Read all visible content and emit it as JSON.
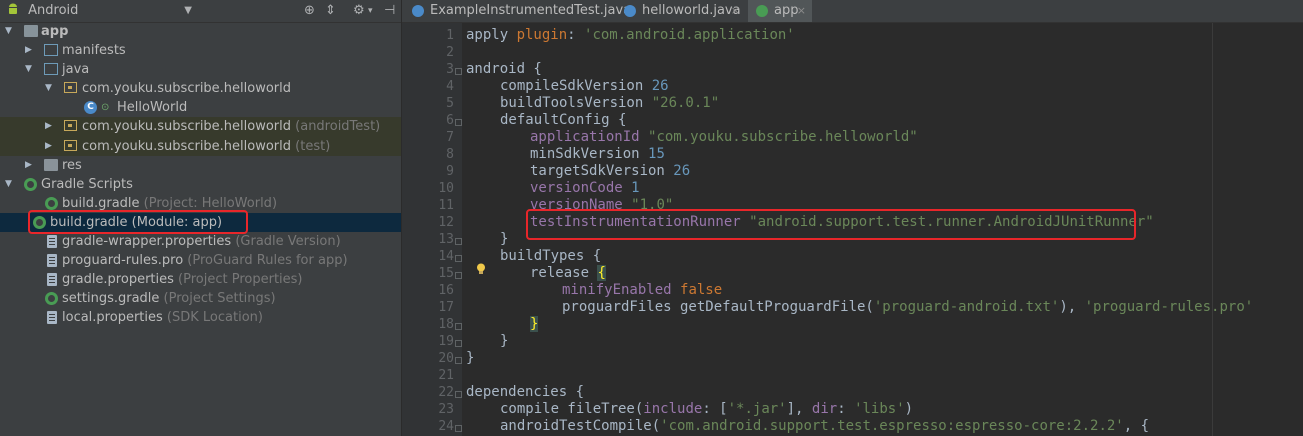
{
  "project": {
    "view_label": "Android",
    "toolbar_icons": [
      "target-icon",
      "collapse-icon",
      "gear-icon",
      "hide-icon"
    ],
    "tree": [
      {
        "label": "app",
        "hint": "",
        "bold": true
      },
      {
        "label": "manifests",
        "hint": ""
      },
      {
        "label": "java",
        "hint": ""
      },
      {
        "label": "com.youku.subscribe.helloworld",
        "hint": ""
      },
      {
        "label": "HelloWorld",
        "hint": ""
      },
      {
        "label": "com.youku.subscribe.helloworld",
        "hint": "(androidTest)"
      },
      {
        "label": "com.youku.subscribe.helloworld",
        "hint": "(test)"
      },
      {
        "label": "res",
        "hint": ""
      },
      {
        "label": "Gradle Scripts",
        "hint": ""
      },
      {
        "label": "build.gradle",
        "hint": "(Project: HelloWorld)"
      },
      {
        "label": "build.gradle (Module: app)",
        "hint": ""
      },
      {
        "label": "gradle-wrapper.properties",
        "hint": "(Gradle Version)"
      },
      {
        "label": "proguard-rules.pro",
        "hint": "(ProGuard Rules for app)"
      },
      {
        "label": "gradle.properties",
        "hint": "(Project Properties)"
      },
      {
        "label": "settings.gradle",
        "hint": "(Project Settings)"
      },
      {
        "label": "local.properties",
        "hint": "(SDK Location)"
      }
    ]
  },
  "tabs": [
    {
      "label": "ExampleInstrumentedTest.java",
      "active": false
    },
    {
      "label": "helloworld.java",
      "active": false
    },
    {
      "label": "app",
      "active": true
    }
  ],
  "tab_close_glyph": "×",
  "line_numbers": [
    "1",
    "2",
    "3",
    "4",
    "5",
    "6",
    "7",
    "8",
    "9",
    "10",
    "11",
    "12",
    "13",
    "14",
    "15",
    "16",
    "17",
    "18",
    "19",
    "20",
    "21",
    "22",
    "23",
    "24"
  ],
  "code": {
    "l1a": "apply ",
    "l1b": "plugin",
    "l1c": ": ",
    "l1d": "'com.android.application'",
    "l3": "android {",
    "l4a": "compileSdkVersion ",
    "l4b": "26",
    "l5a": "buildToolsVersion ",
    "l5b": "\"26.0.1\"",
    "l6": "defaultConfig {",
    "l7a": "applicationId ",
    "l7b": "\"com.youku.subscribe.helloworld\"",
    "l8a": "minSdkVersion ",
    "l8b": "15",
    "l9a": "targetSdkVersion ",
    "l9b": "26",
    "l10a": "versionCode ",
    "l10b": "1",
    "l11a": "versionName ",
    "l11b": "\"1.0\"",
    "l12a": "testInstrumentationRunner ",
    "l12b": "\"android.support.test.runner.AndroidJUnitRunner\"",
    "l13": "}",
    "l14": "buildTypes {",
    "l15a": "release ",
    "l15b": "{",
    "l16a": "minifyEnabled ",
    "l16b": "false",
    "l17a": "proguardFiles getDefaultProguardFile(",
    "l17b": "'proguard-android.txt'",
    "l17c": "), ",
    "l17d": "'proguard-rules.pro'",
    "l18": "}",
    "l19": "}",
    "l20": "}",
    "l22": "dependencies {",
    "l23a": "compile fileTree(",
    "l23b": "include",
    "l23c": ": [",
    "l23d": "'*.jar'",
    "l23e": "], ",
    "l23f": "dir",
    "l23g": ": ",
    "l23h": "'libs'",
    "l23i": ")",
    "l24a": "androidTestCompile(",
    "l24b": "'com.android.support.test.espresso:espresso-core:2.2.2'",
    "l24c": ", {"
  },
  "colors": {
    "keyword": "#cc7832",
    "string": "#6a8759",
    "number": "#6897bb",
    "property": "#9876aa",
    "highlight_box": "#e8262a"
  }
}
